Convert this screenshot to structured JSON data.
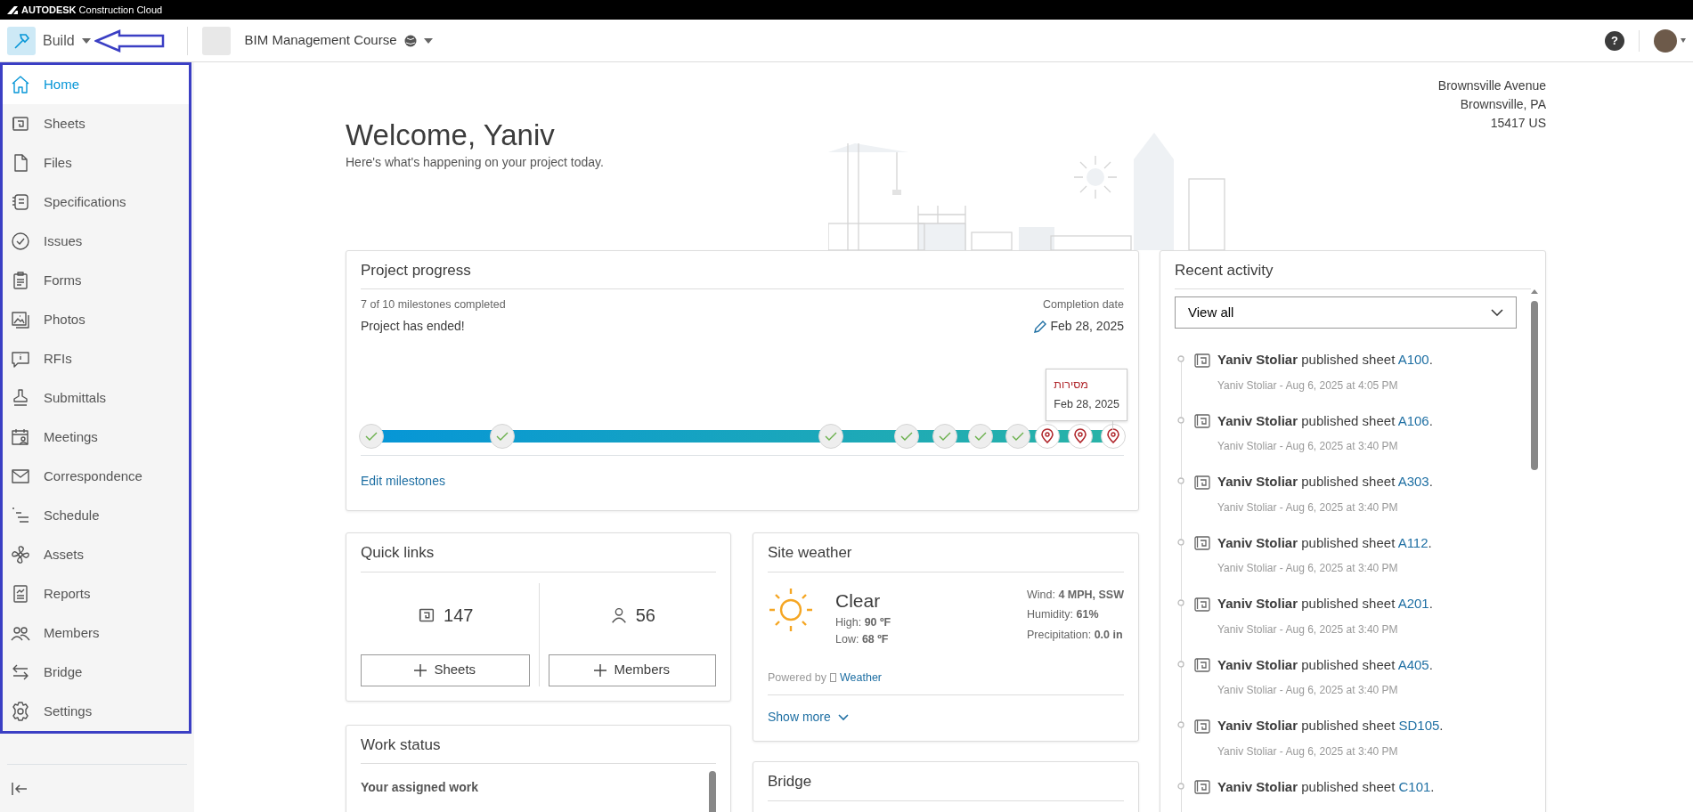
{
  "brand_bar": {
    "logo_bold": "AUTODESK",
    "logo_rest": "Construction Cloud"
  },
  "header": {
    "module": "Build",
    "project": "BIM Management Course",
    "help": "?"
  },
  "sidebar": {
    "items": [
      {
        "label": "Home",
        "selected": true
      },
      {
        "label": "Sheets",
        "selected": false
      },
      {
        "label": "Files",
        "selected": false
      },
      {
        "label": "Specifications",
        "selected": false
      },
      {
        "label": "Issues",
        "selected": false
      },
      {
        "label": "Forms",
        "selected": false
      },
      {
        "label": "Photos",
        "selected": false
      },
      {
        "label": "RFIs",
        "selected": false
      },
      {
        "label": "Submittals",
        "selected": false
      },
      {
        "label": "Meetings",
        "selected": false
      },
      {
        "label": "Correspondence",
        "selected": false
      },
      {
        "label": "Schedule",
        "selected": false
      },
      {
        "label": "Assets",
        "selected": false
      },
      {
        "label": "Reports",
        "selected": false
      },
      {
        "label": "Members",
        "selected": false
      },
      {
        "label": "Bridge",
        "selected": false
      },
      {
        "label": "Settings",
        "selected": false
      }
    ]
  },
  "welcome": {
    "title": "Welcome, Yaniv",
    "subtitle": "Here's what's happening on your project today."
  },
  "address": [
    "Brownsville Avenue",
    "Brownsville, PA",
    "15417 US"
  ],
  "project_progress": {
    "title": "Project progress",
    "milestones_text": "7 of 10 milestones completed",
    "status": "Project has ended!",
    "completion_label": "Completion date",
    "completion_date": "Feb 28, 2025",
    "level": 1,
    "milestones": [
      {
        "kind": "done"
      },
      {
        "kind": "done"
      },
      {
        "kind": "done"
      },
      {
        "kind": "done"
      },
      {
        "kind": "done"
      },
      {
        "kind": "done"
      },
      {
        "kind": "done"
      },
      {
        "kind": "pending"
      },
      {
        "kind": "pending"
      },
      {
        "kind": "pending",
        "tooltip": {
          "title": "מסירות",
          "date": "Feb 28, 2025"
        }
      }
    ],
    "link": "Edit milestones"
  },
  "quick_links": {
    "title": "Quick links",
    "items": [
      {
        "count": "147",
        "button": "Sheets"
      },
      {
        "count": "56",
        "button": "Members"
      }
    ]
  },
  "work_status": {
    "title": "Work status",
    "subtitle": "Your assigned work"
  },
  "site_weather": {
    "title": "Site weather",
    "condition": "Clear",
    "high": "High: **90 ºF**",
    "low": "Low: **68 ºF**",
    "wind": "Wind: **4 MPH, SSW**",
    "humidity": "Humidity: **61%**",
    "precipitation": "Precipitation: **0.0 in**",
    "powered_by": "Powered by",
    "provider": "Weather",
    "show_more": "Show more"
  },
  "bridge": {
    "title": "Bridge"
  },
  "recent_activity": {
    "title": "Recent activity",
    "filter": "View all",
    "items": [
      {
        "text": "**Yaniv Stoliar** published sheet ",
        "sheet": "A100",
        "after": ".",
        "meta": "Yaniv Stoliar - Aug 6, 2025 at 4:05 PM"
      },
      {
        "text": "**Yaniv Stoliar** published sheet ",
        "sheet": "A106",
        "after": ".",
        "meta": "Yaniv Stoliar - Aug 6, 2025 at 3:40 PM"
      },
      {
        "text": "**Yaniv Stoliar** published sheet ",
        "sheet": "A303",
        "after": ".",
        "meta": "Yaniv Stoliar - Aug 6, 2025 at 3:40 PM"
      },
      {
        "text": "**Yaniv Stoliar** published sheet ",
        "sheet": "A112",
        "after": ".",
        "meta": "Yaniv Stoliar - Aug 6, 2025 at 3:40 PM"
      },
      {
        "text": "**Yaniv Stoliar** published sheet ",
        "sheet": "A201",
        "after": ".",
        "meta": "Yaniv Stoliar - Aug 6, 2025 at 3:40 PM"
      },
      {
        "text": "**Yaniv Stoliar** published sheet ",
        "sheet": "A405",
        "after": ".",
        "meta": "Yaniv Stoliar - Aug 6, 2025 at 3:40 PM"
      },
      {
        "text": "**Yaniv Stoliar** published sheet ",
        "sheet": "SD105",
        "after": ".",
        "meta": "Yaniv Stoliar - Aug 6, 2025 at 3:40 PM"
      },
      {
        "text": "**Yaniv Stoliar** published sheet ",
        "sheet": "C101",
        "after": "."
      }
    ]
  }
}
